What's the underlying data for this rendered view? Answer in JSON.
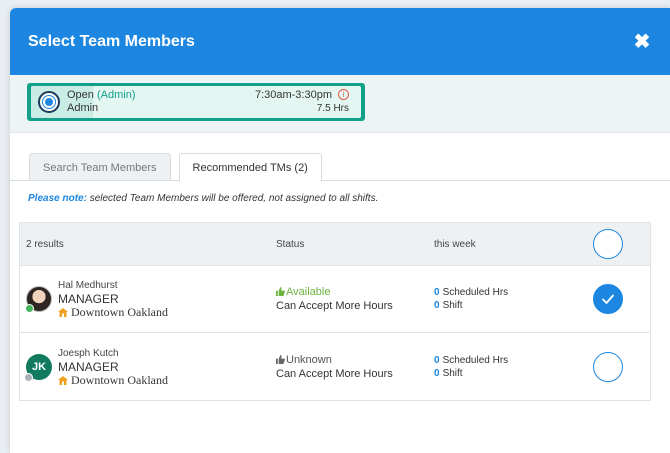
{
  "modal": {
    "title": "Select Team Members",
    "close_glyph": "✖"
  },
  "shift": {
    "status": "Open",
    "role_tag": "(Admin)",
    "role": "Admin",
    "time": "7:30am-3:30pm",
    "hours": "7.5 Hrs",
    "info_glyph": "i",
    "accent_color": "#12a08b"
  },
  "tabs": [
    {
      "label": "Search Team Members",
      "active": false
    },
    {
      "label": "Recommended TMs (2)",
      "active": true
    }
  ],
  "note": {
    "prefix": "Please note:",
    "text": " selected Team Members will be offered, not assigned to all shifts."
  },
  "table": {
    "headers": {
      "results": "2 results",
      "status": "Status",
      "week": "this week"
    },
    "rows": [
      {
        "name": "Hal Medhurst",
        "role": "MANAGER",
        "location": "Downtown Oakland",
        "avatar": "photo",
        "presence": "green",
        "status": "Available",
        "status_sub": "Can Accept More Hours",
        "scheduled_num": "0",
        "scheduled_label": "Scheduled Hrs",
        "shift_num": "0",
        "shift_label": "Shift",
        "selected": true
      },
      {
        "name": "Joesph Kutch",
        "role": "MANAGER",
        "location": "Downtown Oakland",
        "avatar_initials": "JK",
        "presence": "gray",
        "status": "Unknown",
        "status_sub": "Can Accept More Hours",
        "scheduled_num": "0",
        "scheduled_label": "Scheduled Hrs",
        "shift_num": "0",
        "shift_label": "Shift",
        "selected": false
      }
    ]
  },
  "colors": {
    "header": "#1d86e0",
    "available": "#6db33f",
    "link": "#1d86e0"
  }
}
